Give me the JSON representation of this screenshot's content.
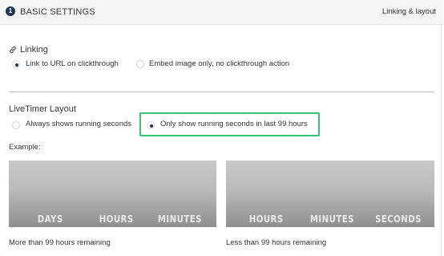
{
  "header": {
    "step_number": "1",
    "title": "BASIC SETTINGS",
    "right_link": "Linking & layout"
  },
  "linking": {
    "title": "Linking",
    "icon": "link-icon",
    "options": [
      {
        "label": "Link to URL on clickthrough",
        "selected": true
      },
      {
        "label": "Embed image only, no clickthrough action",
        "selected": false
      }
    ]
  },
  "layout": {
    "title": "LiveTimer Layout",
    "options": [
      {
        "label": "Always shows running seconds",
        "selected": false
      },
      {
        "label": "Only show running seconds in last 99 hours",
        "selected": true
      }
    ],
    "highlight_color": "#35c473"
  },
  "example": {
    "label": "Example:",
    "previews": [
      {
        "units": [
          "DAYS",
          "HOURS",
          "MINUTES"
        ],
        "caption": "More than 99 hours remaining"
      },
      {
        "units": [
          "HOURS",
          "MINUTES",
          "SECONDS"
        ],
        "caption": "Less than 99 hours remaining"
      }
    ]
  },
  "colors": {
    "accent": "#1f3550",
    "highlight": "#35c473"
  }
}
